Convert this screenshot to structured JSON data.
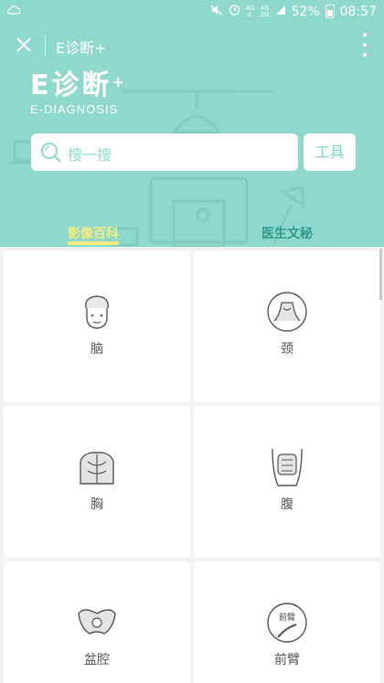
{
  "status_bar": {
    "network": "4G",
    "network2": "4G",
    "network2_sub": "2G",
    "battery": "52%",
    "time": "08:57"
  },
  "nav": {
    "title": "E诊断+"
  },
  "brand": {
    "name": "E诊断",
    "sup": "+",
    "subtitle": "E-DIAGNOSIS"
  },
  "search": {
    "placeholder": "搜一搜",
    "tools_label": "工具"
  },
  "tabs": [
    {
      "label": "影像百科",
      "active": true
    },
    {
      "label": "医生文秘",
      "active": false
    }
  ],
  "categories": [
    {
      "label": "脑",
      "icon": "head-icon"
    },
    {
      "label": "颈",
      "icon": "neck-icon"
    },
    {
      "label": "胸",
      "icon": "chest-icon"
    },
    {
      "label": "腹",
      "icon": "abdomen-icon"
    },
    {
      "label": "盆腔",
      "icon": "pelvis-icon"
    },
    {
      "label": "前臂",
      "icon": "forearm-icon",
      "icon_text": "前臂"
    }
  ],
  "colors": {
    "header_bg": "#8fd9cc",
    "active_tab": "#f5ec7f",
    "inactive_tab": "#2f9a8c",
    "accent": "#7ed3c5"
  }
}
